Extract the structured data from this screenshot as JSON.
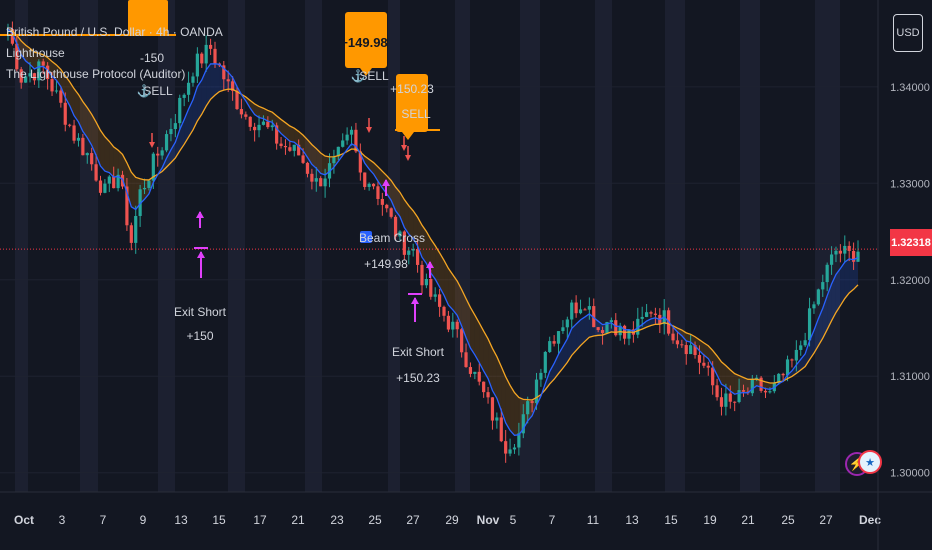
{
  "symbol_title": "British Pound / U.S. Dollar · 4h · OANDA",
  "indicator_1": "Lighthouse",
  "indicator_2": "The Lighthouse Protocol (Auditor)",
  "currency_button": "USD",
  "current_price": "1.32318",
  "colors": {
    "background": "#131722",
    "up": "#26a69a",
    "down": "#ef5350",
    "fast_ma": "#2962ff",
    "slow_ma": "#f5a623",
    "signal_box": "#ff9800",
    "marker": "#e040fb",
    "price_line": "#f23645"
  },
  "annotations": {
    "sell_1_value": "-150",
    "sell_1_label": "SELL",
    "sell_2_value": "+149.98",
    "sell_2_label": "SELL",
    "sell_3_value": "+150.23",
    "sell_3_label": "SELL",
    "exit_1_label": "Exit Short",
    "exit_1_value": "+150",
    "beam_label": "Beam Cross",
    "beam_value": "+149.98",
    "exit_2_label": "Exit Short",
    "exit_2_value": "+150.23"
  },
  "chart_data": {
    "type": "candlestick",
    "ylim": [
      1.298,
      1.349
    ],
    "y_ticks": [
      "1.34000",
      "1.33000",
      "1.32000",
      "1.31000",
      "1.30000"
    ],
    "x_ticks": [
      "Oct",
      "3",
      "7",
      "9",
      "13",
      "15",
      "17",
      "21",
      "23",
      "25",
      "27",
      "29",
      "Nov",
      "5",
      "7",
      "11",
      "13",
      "15",
      "19",
      "21",
      "25",
      "27",
      "Dec"
    ],
    "price_path": [
      [
        0,
        1.346
      ],
      [
        3,
        1.341
      ],
      [
        8,
        1.342
      ],
      [
        12,
        1.338
      ],
      [
        15,
        1.335
      ],
      [
        18,
        1.333
      ],
      [
        22,
        1.329
      ],
      [
        25,
        1.331
      ],
      [
        28,
        1.324
      ],
      [
        30,
        1.329
      ],
      [
        34,
        1.333
      ],
      [
        38,
        1.337
      ],
      [
        42,
        1.342
      ],
      [
        46,
        1.344
      ],
      [
        50,
        1.34
      ],
      [
        54,
        1.337
      ],
      [
        58,
        1.336
      ],
      [
        62,
        1.334
      ],
      [
        66,
        1.333
      ],
      [
        70,
        1.33
      ],
      [
        74,
        1.332
      ],
      [
        78,
        1.335
      ],
      [
        80,
        1.331
      ],
      [
        83,
        1.33
      ],
      [
        86,
        1.327
      ],
      [
        89,
        1.324
      ],
      [
        92,
        1.323
      ],
      [
        95,
        1.319
      ],
      [
        98,
        1.317
      ],
      [
        101,
        1.315
      ],
      [
        104,
        1.312
      ],
      [
        107,
        1.309
      ],
      [
        110,
        1.306
      ],
      [
        113,
        1.303
      ],
      [
        116,
        1.304
      ],
      [
        119,
        1.308
      ],
      [
        122,
        1.313
      ],
      [
        125,
        1.315
      ],
      [
        128,
        1.317
      ],
      [
        131,
        1.318
      ],
      [
        134,
        1.315
      ],
      [
        137,
        1.316
      ],
      [
        140,
        1.314
      ],
      [
        143,
        1.315
      ],
      [
        146,
        1.317
      ],
      [
        149,
        1.316
      ],
      [
        152,
        1.314
      ],
      [
        155,
        1.313
      ],
      [
        158,
        1.311
      ],
      [
        161,
        1.308
      ],
      [
        164,
        1.307
      ],
      [
        167,
        1.308
      ],
      [
        170,
        1.309
      ],
      [
        173,
        1.308
      ],
      [
        176,
        1.31
      ],
      [
        179,
        1.312
      ],
      [
        182,
        1.316
      ],
      [
        185,
        1.32
      ],
      [
        188,
        1.323
      ],
      [
        191,
        1.3225
      ],
      [
        193,
        1.3232
      ]
    ],
    "n_candles": 194
  }
}
